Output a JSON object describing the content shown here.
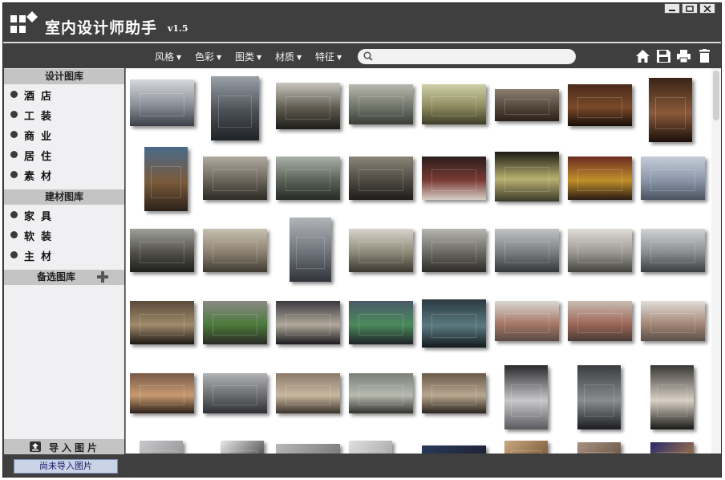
{
  "app": {
    "title": "室内设计师助手",
    "version": "v1.5"
  },
  "colors": {
    "chrome": "#3f3f3f",
    "sidebar_bg": "#f0f0f2",
    "section_header": "#c4c4c4",
    "status_button": "#c9d3e6"
  },
  "window_controls": [
    "minimize-icon",
    "maximize-icon",
    "close-icon"
  ],
  "menu": [
    {
      "label": "风格",
      "icon": "caret-down-icon"
    },
    {
      "label": "色彩",
      "icon": "caret-down-icon"
    },
    {
      "label": "图类",
      "icon": "caret-down-icon"
    },
    {
      "label": "材质",
      "icon": "caret-down-icon"
    },
    {
      "label": "特征",
      "icon": "caret-down-icon"
    }
  ],
  "search": {
    "value": "",
    "placeholder": "",
    "icon": "search-icon"
  },
  "toolbar_icons": [
    "home-icon",
    "save-icon",
    "print-icon",
    "trash-icon"
  ],
  "sidebar": {
    "design_library": {
      "title": "设计图库",
      "items": [
        "酒店",
        "工装",
        "商业",
        "居住",
        "素材"
      ]
    },
    "material_library": {
      "title": "建材图库",
      "items": [
        "家具",
        "软装",
        "主材"
      ]
    },
    "alternate_library": {
      "title": "备选图库",
      "icon": "plus-icon"
    },
    "import_label": "导入图片",
    "import_icon": "upload-icon",
    "status_text": "尚未导入图片"
  },
  "gallery": {
    "thumbnails": [
      {
        "c": [
          "#d6d8dc",
          "#8a8f98",
          "#3d4048"
        ]
      },
      {
        "c": [
          "#9aa0a8",
          "#4a4f55",
          "#202326"
        ]
      },
      {
        "c": [
          "#c8c6bd",
          "#5e5a50",
          "#1d1c19"
        ]
      },
      {
        "c": [
          "#b8b8ae",
          "#72766b",
          "#3a3d35"
        ]
      },
      {
        "c": [
          "#cfcfa8",
          "#8f8c5f",
          "#3e3d28"
        ]
      },
      {
        "c": [
          "#8b7f72",
          "#55483c",
          "#2a211a"
        ]
      },
      {
        "c": [
          "#4a2a1a",
          "#7a4a2a",
          "#1a0e08"
        ]
      },
      {
        "c": [
          "#3a2416",
          "#8a5a3a",
          "#1a100a"
        ]
      },
      {
        "c": [
          "#4a6a8a",
          "#7a5a3a",
          "#2a2018"
        ]
      },
      {
        "c": [
          "#b0aaa0",
          "#6a645a",
          "#2c2a25"
        ]
      },
      {
        "c": [
          "#a8b0a8",
          "#5a6258",
          "#262a25"
        ]
      },
      {
        "c": [
          "#8a8478",
          "#4e4a42",
          "#1f1d1a"
        ]
      },
      {
        "c": [
          "#2a1e1c",
          "#7a3a34",
          "#d8d0c8"
        ]
      },
      {
        "c": [
          "#1a1a14",
          "#b8b070",
          "#3a3a2a"
        ]
      },
      {
        "c": [
          "#6a2a20",
          "#c0902a",
          "#2a1a14"
        ]
      },
      {
        "c": [
          "#c4ccd8",
          "#8a96a8",
          "#4a5260"
        ]
      },
      {
        "c": [
          "#a0a09a",
          "#505048",
          "#1e1e1c"
        ]
      },
      {
        "c": [
          "#c8c0b0",
          "#8a8070",
          "#3e3a32"
        ]
      },
      {
        "c": [
          "#b0b4b8",
          "#6e737a",
          "#30343a"
        ]
      },
      {
        "c": [
          "#d8d4cc",
          "#8e8878",
          "#3a3630"
        ]
      },
      {
        "c": [
          "#b8b6b0",
          "#6a6862",
          "#2c2b28"
        ]
      },
      {
        "c": [
          "#c0c2c4",
          "#7a7c80",
          "#34363a"
        ]
      },
      {
        "c": [
          "#e0ddd6",
          "#9a9890",
          "#44433e"
        ]
      },
      {
        "c": [
          "#d0d2d4",
          "#8a8c90",
          "#3c3e42"
        ]
      },
      {
        "c": [
          "#5a4a3a",
          "#a08a6a",
          "#1e1814"
        ]
      },
      {
        "c": [
          "#8a8a86",
          "#4a7a3a",
          "#2a2a26"
        ]
      },
      {
        "c": [
          "#3a3a40",
          "#b0a89a",
          "#1a1a1e"
        ]
      },
      {
        "c": [
          "#4a5a6a",
          "#4a8a5a",
          "#1e2228"
        ]
      },
      {
        "c": [
          "#2a3a40",
          "#5a7a80",
          "#121a1e"
        ]
      },
      {
        "c": [
          "#d8d8d4",
          "#a87a6a",
          "#5a4a44"
        ]
      },
      {
        "c": [
          "#c8beb4",
          "#a06a5a",
          "#4a3a34"
        ]
      },
      {
        "c": [
          "#e0ddd8",
          "#a88a7a",
          "#5a4e48"
        ]
      },
      {
        "c": [
          "#7a5a48",
          "#c89a70",
          "#2c2018"
        ]
      },
      {
        "c": [
          "#b0b2b4",
          "#6a6c70",
          "#2e3034"
        ]
      },
      {
        "c": [
          "#8a7a6a",
          "#c8b8a0",
          "#3a322a"
        ]
      },
      {
        "c": [
          "#7a8078",
          "#b8bab0",
          "#30322e"
        ]
      },
      {
        "c": [
          "#6a5a4a",
          "#b8a890",
          "#2a241e"
        ]
      },
      {
        "c": [
          "#2a2a2c",
          "#c8c8ca",
          "#5a5a5e"
        ]
      },
      {
        "c": [
          "#3a3c40",
          "#8a8c90",
          "#1a1c1e"
        ]
      },
      {
        "c": [
          "#3a3836",
          "#d8d0c4",
          "#1a1918"
        ]
      },
      {
        "c": [
          "#c8c8ca",
          "#8a8a8c"
        ]
      },
      {
        "c": [
          "#e8e8e8",
          "#2a2a2a"
        ]
      },
      {
        "c": [
          "#b8b8b8",
          "#6a6a6a"
        ]
      },
      {
        "c": [
          "#e0e0e0",
          "#9a9a9a"
        ]
      },
      {
        "c": [
          "#2a3a5a",
          "#1a1a2a"
        ]
      },
      {
        "c": [
          "#c8a880",
          "#6a4a2a"
        ]
      },
      {
        "c": [
          "#a89080",
          "#5a4a3a"
        ]
      },
      {
        "c": [
          "#2a2a6a",
          "#c08a40"
        ]
      }
    ]
  }
}
